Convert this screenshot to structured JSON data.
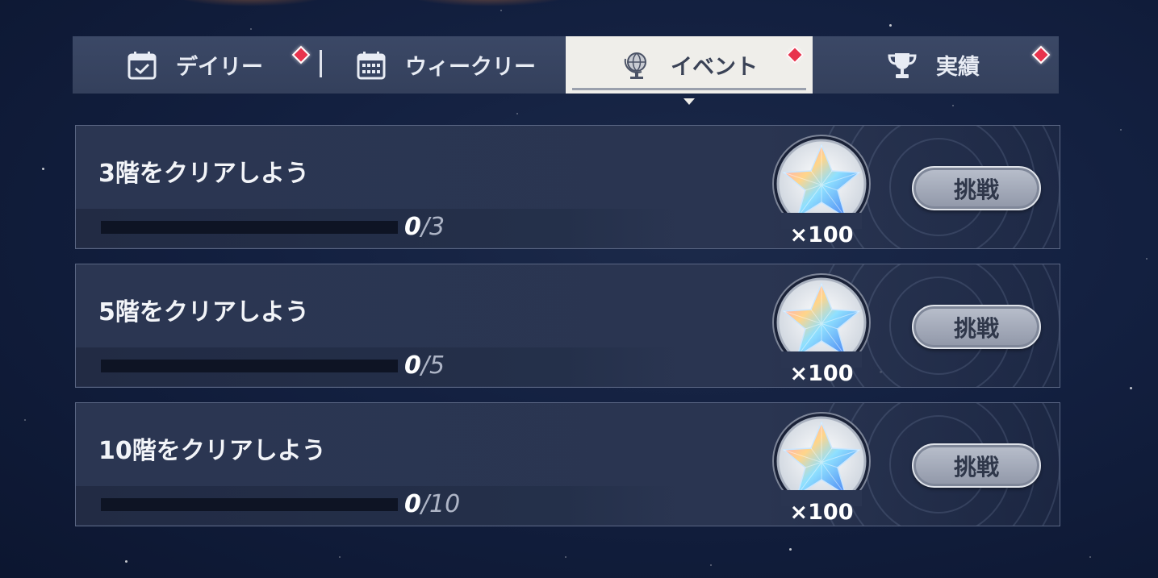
{
  "tabs": [
    {
      "label": "デイリー",
      "icon": "calendar-check-icon",
      "badge": true
    },
    {
      "label": "ウィークリー",
      "icon": "calendar-grid-icon",
      "badge": false
    },
    {
      "label": "イベント",
      "icon": "globe-icon",
      "badge": true,
      "selected": true
    },
    {
      "label": "実績",
      "icon": "trophy-icon",
      "badge": true
    }
  ],
  "missions": [
    {
      "title": "3階をクリアしよう",
      "progress_current": "0",
      "progress_total": "/3",
      "progress_fraction": 0,
      "reward_icon": "rainbow-star-crystal-icon",
      "reward_count": "×100",
      "button_label": "挑戦"
    },
    {
      "title": "5階をクリアしよう",
      "progress_current": "0",
      "progress_total": "/5",
      "progress_fraction": 0,
      "reward_icon": "rainbow-star-crystal-icon",
      "reward_count": "×100",
      "button_label": "挑戦"
    },
    {
      "title": "10階をクリアしよう",
      "progress_current": "0",
      "progress_total": "/10",
      "progress_fraction": 0,
      "reward_icon": "rainbow-star-crystal-icon",
      "reward_count": "×100",
      "button_label": "挑戦"
    }
  ],
  "colors": {
    "badge": "#e8334d",
    "tab_selected_bg": "#efeeea",
    "panel_bg": "#2b3652",
    "button_bg": "#a9afbd"
  }
}
